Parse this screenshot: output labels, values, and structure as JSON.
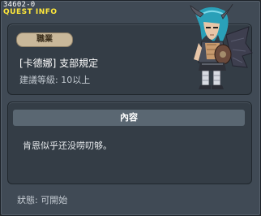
{
  "window": {
    "quest_id": "34602-0",
    "title": "QUEST INFO"
  },
  "info": {
    "job_label": "職業",
    "quest_name": "[卡德娜] 支部規定",
    "recommended_level": "建議等級: 10以上"
  },
  "character": {
    "icon": "demon-slayer-character-icon"
  },
  "content": {
    "header": "內容",
    "text": "肯恩似乎还没唠叨够。"
  },
  "status": {
    "text": "狀態:  可開始"
  },
  "colors": {
    "title_yellow": "#ffe83a",
    "window_bg": "#404a55",
    "panel_bg": "#343d46",
    "badge_bg": "#c9b89a"
  }
}
